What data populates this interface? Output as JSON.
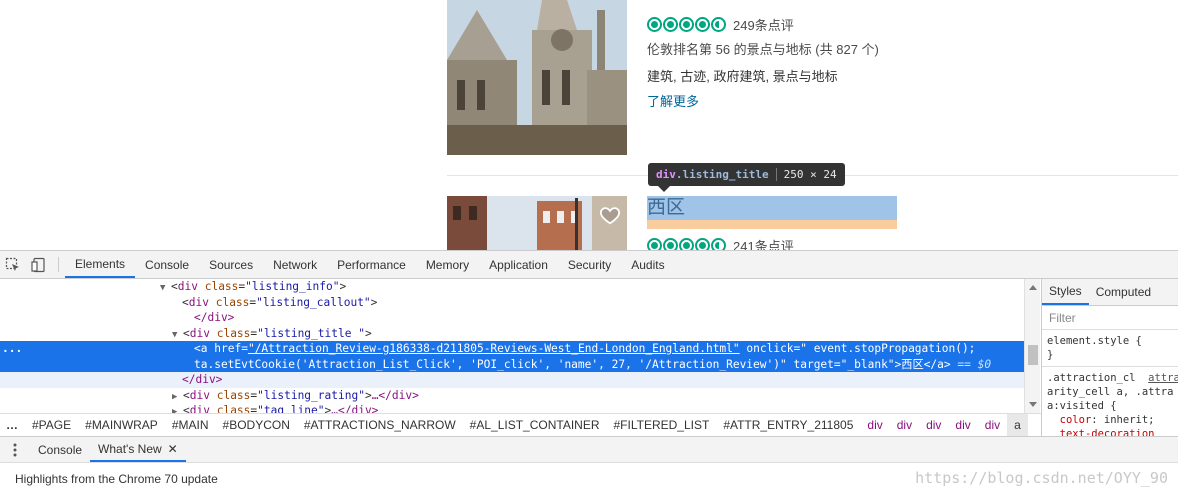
{
  "page": {
    "listing1": {
      "review_count": "249条点评",
      "rank": "伦敦排名第 56 的景点与地标 (共 827 个)",
      "tags": "建筑, 古迹, 政府建筑, 景点与地标",
      "learn_more": "了解更多"
    },
    "listing2": {
      "title": "西区",
      "review_count": "241条点评"
    },
    "rating_bubbles": 4.5,
    "tooltip": {
      "tag": "div",
      "class": ".listing_title",
      "size": "250 × 24"
    }
  },
  "devtools": {
    "tabs": [
      "Elements",
      "Console",
      "Sources",
      "Network",
      "Performance",
      "Memory",
      "Application",
      "Security",
      "Audits"
    ],
    "active_tab": "Elements",
    "dom": {
      "l1_tag": "div",
      "l1_attr": "class",
      "l1_val": "\"listing_info\"",
      "l2_tag": "div",
      "l2_attr": "class",
      "l2_val": "\"listing_callout\"",
      "l3_close": "</div>",
      "l4_tag": "div",
      "l4_attr": "class",
      "l4_val": "\"listing_title \"",
      "l5_tag": "a",
      "l5_href_attr": "href",
      "l5_href": "\"/Attraction_Review-g186338-d211805-Reviews-West_End-London_England.html\"",
      "l5_onclick_attr": "onclick",
      "l5_onclick": "\" event.stopPropagation();",
      "l6_onclick_cont": "ta.setEvtCookie('Attraction_List_Click', 'POI_click', 'name', 27, '/Attraction_Review')\"",
      "l6_target_attr": "target",
      "l6_target": "\"_blank\"",
      "l6_text": "西区",
      "l6_close": "</a>",
      "l6_eq": "== $0",
      "l7_close": "</div>",
      "l8_tag": "div",
      "l8_attr": "class",
      "l8_val": "\"listing_rating\"",
      "l8_tail": "…</div>",
      "l9_tag": "div",
      "l9_attr": "class",
      "l9_val": "\"tag_line\"",
      "l9_tail": "…</div>"
    },
    "styles_tabs": [
      "Styles",
      "Computed"
    ],
    "styles_filter": "Filter",
    "element_style_selector": "element.style {",
    "element_style_close": "}",
    "rule_selector1": ".attraction_cl",
    "rule_link": "attra",
    "rule_selector2": "arity_cell a, .attra",
    "rule_selector3": "a:visited {",
    "rule_prop": "color",
    "rule_value": ": inherit;",
    "rule_prop2": "text-decoration",
    "breadcrumbs": [
      "#PAGE",
      "#MAINWRAP",
      "#MAIN",
      "#BODYCON",
      "#ATTRACTIONS_NARROW",
      "#AL_LIST_CONTAINER",
      "#FILTERED_LIST",
      "#ATTR_ENTRY_211805",
      "div",
      "div",
      "div",
      "div",
      "div",
      "a"
    ],
    "drawer_tabs": [
      "Console",
      "What's New"
    ],
    "drawer_active": "What's New",
    "drawer_message": "Highlights from the Chrome 70 update",
    "watermark": "https://blog.csdn.net/OYY_90"
  },
  "colors": {
    "rating": "#00a680",
    "selection": "#1a73e8",
    "highlight": "#a0c3e8",
    "margin": "#f9cc9d"
  }
}
